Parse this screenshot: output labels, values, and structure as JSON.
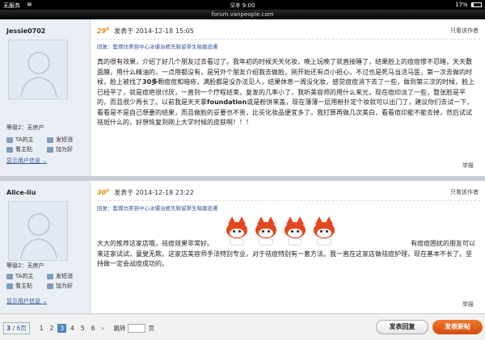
{
  "status_bar": {
    "carrier": "无服务",
    "time": "오후 9:00",
    "battery": "17%"
  },
  "url_bar": {
    "url": "forum.vanpeople.com"
  },
  "posts": [
    {
      "username": "Jessie0702",
      "floor": "29",
      "floor_suffix": "#",
      "posted_label": "发表于",
      "posted_at": "2014-12-18 15:05",
      "only_author_label": "只看该作者",
      "reply_to": "回复：藍蝶坊美容中心冰爆治癒先斅留學生暗瘡皮膚",
      "body_segments": [
        "真的很有效果，介绍了好几个朋友过去看过了。我年初的时候天天化妆，晚上玩晚了就直接睡了，结果脸上的痘痘惨不忍睹，天天敷面膜，用什么精油的，一点用都没有，是另外个朋友介绍我去做脸，刚开始还有点小担心，不过也是死马当活马医，第一次去做的时候，脸上被找了",
        "30多",
        "颗痘痘和暗疮，满脸都是没办法见人，结果休息一周没化妆，感觉痘痘消下去了一些，做到第三次的时候，脸上已经平了，就是痘疤很讨厌，一直到一个疗程结束，复发的几率小了，我听美容师的用什么来光，现在痘印淡了一些，整张脸是平的，而且很少再长了。以前我是天天拿",
        "foundation",
        "或是粉饼来盖，现在薄薄一层用粉扑定个妆就可以出门了，建议你们去试一下，看看是不是自己想要的结果，而且做脸的妥要也不贵，比买化妆品便宜多了。我打算再做几次美白，看看痘印能不能去掉，然后试试祛斑什么的，好想恢复到刚上大学时候的皮肤啊！！！"
      ],
      "rank": "等级2：无房户",
      "action_ta": "TA的主",
      "action_msg": "发短消",
      "action_view": "看主贴",
      "action_friend": "加为好",
      "show_info": "显示用户信息",
      "report": "举报"
    },
    {
      "username": "Alice-liu",
      "floor": "30",
      "floor_suffix": "#",
      "posted_label": "发表于",
      "posted_at": "2014-12-18 23:22",
      "only_author_label": "只看该作者",
      "reply_to": "回复：藍蝶坊美容中心冰爆治癒先斅留學生暗瘡皮膚",
      "body_line1_left": "大大的推荐这家店哦，祛痘效果非常好。",
      "body_line1_right": "有痘痘困扰的朋友可以",
      "body_rest": "来这家试试，童叟无欺。这家店美容师手法特别专业，对于祛痘特别有一套方法。我一直在这家店做祛痘护理，现在基本不长了。坚持做一定会战痘成功的。",
      "emoji_name": "red-fox-emoticon",
      "rank": "等级2：无房户",
      "action_ta": "TA的主",
      "action_msg": "发短消",
      "action_view": "看主贴",
      "action_friend": "加为好",
      "show_info": "显示用户信息",
      "report": "举报"
    }
  ],
  "pagination": {
    "current": "3",
    "total": "6页",
    "pages": [
      "1",
      "2",
      "3",
      "4",
      "5",
      "6"
    ],
    "active_page": "3",
    "next_glyph": "›",
    "jump_label": "跳转",
    "page_unit": "页"
  },
  "buttons": {
    "reply": "发表回复",
    "new_post": "发表新帖"
  },
  "colors": {
    "floor": "#e08a00",
    "link": "#335599",
    "new_post_btn": "#e0561a",
    "active_page": "#4c86c6"
  }
}
